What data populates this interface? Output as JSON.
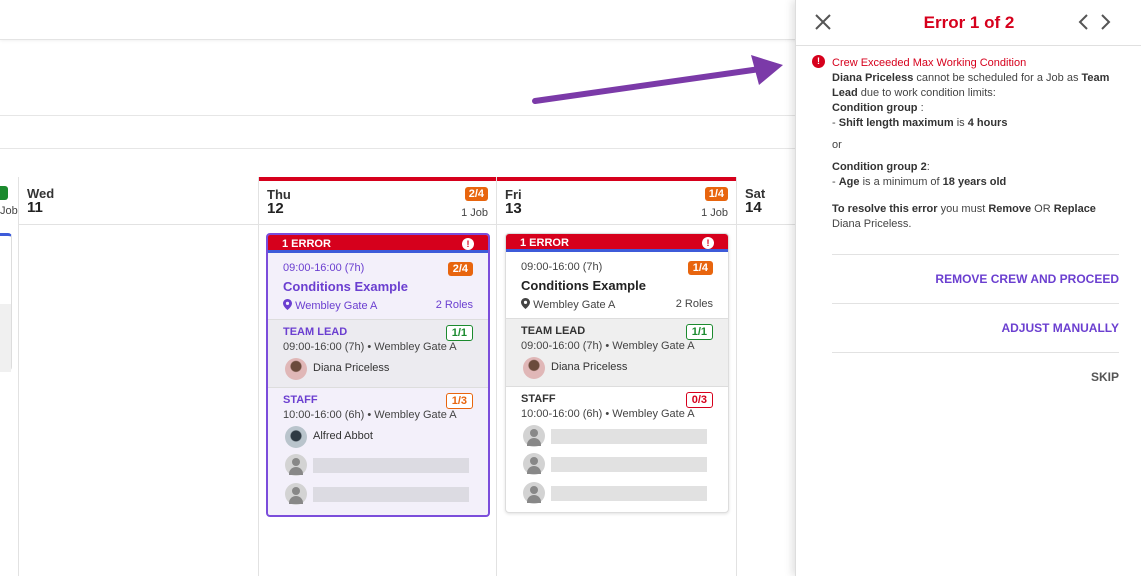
{
  "calendar": {
    "prev_day": {
      "jobs_label": "Job"
    },
    "days": [
      {
        "name": "Wed",
        "num": "11"
      },
      {
        "name": "Thu",
        "num": "12",
        "badge": "2/4",
        "jobs": "1 Job"
      },
      {
        "name": "Fri",
        "num": "13",
        "badge": "1/4",
        "jobs": "1 Job"
      },
      {
        "name": "Sat",
        "num": "14"
      }
    ],
    "cards": [
      {
        "error_label": "1 ERROR",
        "error_icon": "!",
        "time": "09:00-16:00 (7h)",
        "badge": "2/4",
        "title": "Conditions Example",
        "location": "Wembley Gate A",
        "roles": "2 Roles",
        "role_lead": {
          "name": "TEAM LEAD",
          "count": "1/1",
          "time": "09:00-16:00 (7h) • Wembley Gate A",
          "crew": "Diana Priceless"
        },
        "role_staff": {
          "name": "STAFF",
          "count": "1/3",
          "time": "10:00-16:00 (6h) • Wembley Gate A",
          "crew": "Alfred Abbot"
        }
      },
      {
        "error_label": "1 ERROR",
        "error_icon": "!",
        "time": "09:00-16:00 (7h)",
        "badge": "1/4",
        "title": "Conditions Example",
        "location": "Wembley Gate A",
        "roles": "2 Roles",
        "role_lead": {
          "name": "TEAM LEAD",
          "count": "1/1",
          "time": "09:00-16:00 (7h) • Wembley Gate A",
          "crew": "Diana Priceless"
        },
        "role_staff": {
          "name": "STAFF",
          "count": "0/3",
          "time": "10:00-16:00 (6h) • Wembley Gate A"
        }
      }
    ]
  },
  "panel": {
    "title": "Error 1 of 2",
    "error_icon": "!",
    "error_title": "Crew Exceeded Max Working Condition",
    "crew_name": "Diana Priceless",
    "msg_part1": " cannot be scheduled for a Job as ",
    "role_name": "Team Lead",
    "msg_part2": " due to work condition limits:",
    "group1_label": "Condition group",
    "group1_colon": " :",
    "group1_dash": "- ",
    "group1_key": "Shift length maximum",
    "group1_mid": " is ",
    "group1_val": "4 hours",
    "or": "or",
    "group2_label": "Condition group 2",
    "group2_colon": ":",
    "group2_dash": "- ",
    "group2_key": "Age",
    "group2_mid": " is a minimum of ",
    "group2_val": "18 years old",
    "resolve_label": "To resolve this error",
    "resolve_mid": " you must ",
    "resolve_remove": "Remove",
    "resolve_or": " OR ",
    "resolve_replace": "Replace",
    "resolve_name": "Diana Priceless.",
    "actions": {
      "remove": "REMOVE CREW AND PROCEED",
      "adjust": "ADJUST MANUALLY",
      "skip": "SKIP"
    }
  },
  "colors": {
    "error_red": "#d6001c",
    "accent_purple": "#6b3fd0",
    "arrow_purple": "#7b3aa8",
    "badge_orange": "#e8650e",
    "ok_green": "#1b8a2e"
  }
}
